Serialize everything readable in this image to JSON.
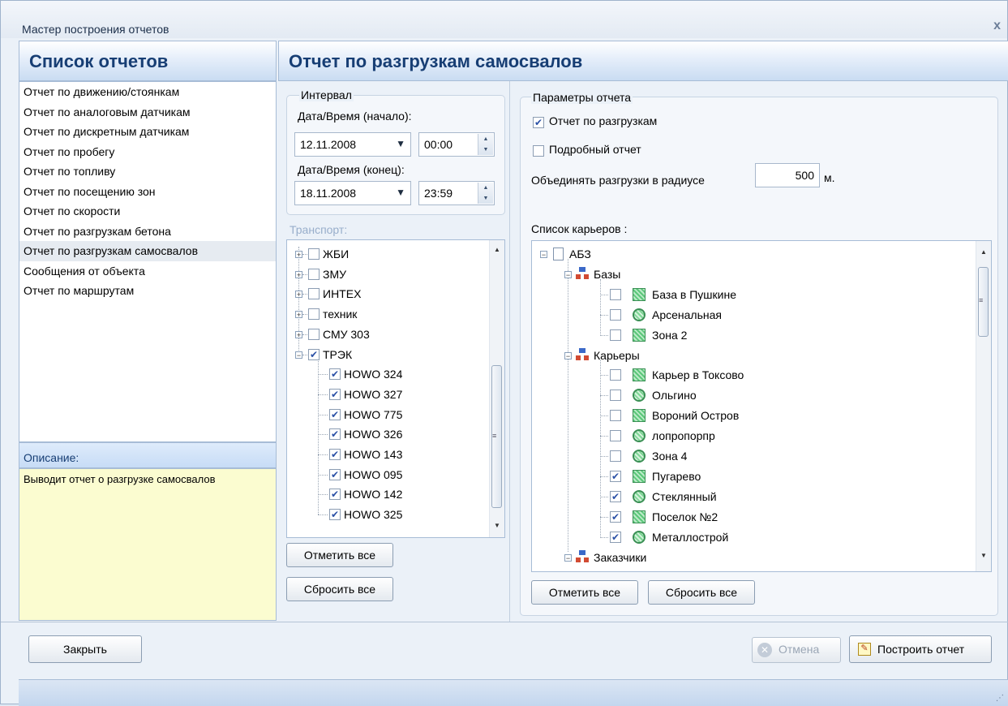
{
  "window": {
    "title": "Мастер построения отчетов",
    "close_glyph": "x"
  },
  "left": {
    "header": "Список отчетов",
    "reports": [
      "Отчет по движению/стоянкам",
      "Отчет по аналоговым датчикам",
      "Отчет по дискретным датчикам",
      "Отчет по пробегу",
      "Отчет по топливу",
      "Отчет по посещению зон",
      "Отчет по скорости",
      "Отчет по разгрузкам бетона",
      "Отчет по разгрузкам самосвалов",
      "Сообщения от объекта",
      "Отчет по маршрутам"
    ],
    "selected_index": 8,
    "description_header": "Описание:",
    "description": "Выводит отчет о разгрузке самосвалов"
  },
  "right": {
    "header": "Отчет по разгрузкам самосвалов",
    "interval": {
      "label": "Интервал",
      "start_label": "Дата/Время (начало):",
      "start_date": "12.11.2008",
      "start_time": "00:00",
      "end_label": "Дата/Время (конец):",
      "end_date": "18.11.2008",
      "end_time": "23:59"
    },
    "transport": {
      "label": "Транспорт:",
      "groups": [
        {
          "name": "ЖБИ",
          "checked": false,
          "expanded": false
        },
        {
          "name": "ЗМУ",
          "checked": false,
          "expanded": false
        },
        {
          "name": "ИНТЕХ",
          "checked": false,
          "expanded": false
        },
        {
          "name": "техник",
          "checked": false,
          "expanded": false
        },
        {
          "name": "СМУ 303",
          "checked": false,
          "expanded": false
        },
        {
          "name": "ТРЭК",
          "checked": true,
          "expanded": true
        }
      ],
      "vehicles": [
        "HOWO 324",
        "HOWO 327",
        "HOWO 775",
        "HOWO 326",
        "HOWO 143",
        "HOWO 095",
        "HOWO 142",
        "HOWO 325"
      ],
      "check_all": "Отметить все",
      "reset_all": "Сбросить все"
    },
    "params": {
      "label": "Параметры отчета",
      "unloads_label": "Отчет по разгрузкам",
      "unloads_checked": true,
      "detailed_label": "Подробный отчет",
      "detailed_checked": false,
      "radius_label": "Объединять разгрузки в радиусе",
      "radius_value": "500",
      "radius_unit": "м."
    },
    "quarries": {
      "label": "Список карьеров :",
      "root": "АБЗ",
      "bases_label": "Базы",
      "bases": [
        {
          "name": "База в Пушкине",
          "icon": "square-zone",
          "checked": false
        },
        {
          "name": "Арсенальная",
          "icon": "circle-zone",
          "checked": false
        },
        {
          "name": "Зона 2",
          "icon": "square-zone",
          "checked": false
        }
      ],
      "quarries_label": "Карьеры",
      "items": [
        {
          "name": "Карьер в Токсово",
          "icon": "square-zone",
          "checked": false
        },
        {
          "name": "Ольгино",
          "icon": "circle-zone",
          "checked": false
        },
        {
          "name": "Вороний Остров",
          "icon": "square-zone",
          "checked": false
        },
        {
          "name": "лопропорпр",
          "icon": "circle-zone",
          "checked": false
        },
        {
          "name": "Зона 4",
          "icon": "circle-zone",
          "checked": false
        },
        {
          "name": "Пугарево",
          "icon": "square-zone",
          "checked": true
        },
        {
          "name": "Стеклянный",
          "icon": "circle-zone",
          "checked": true
        },
        {
          "name": "Поселок №2",
          "icon": "square-zone",
          "checked": true
        },
        {
          "name": "Металлострой",
          "icon": "circle-zone",
          "checked": true
        }
      ],
      "customers_label": "Заказчики",
      "check_all": "Отметить все",
      "reset_all": "Сбросить все"
    }
  },
  "footer": {
    "close": "Закрыть",
    "cancel": "Отмена",
    "build": "Построить отчет"
  }
}
